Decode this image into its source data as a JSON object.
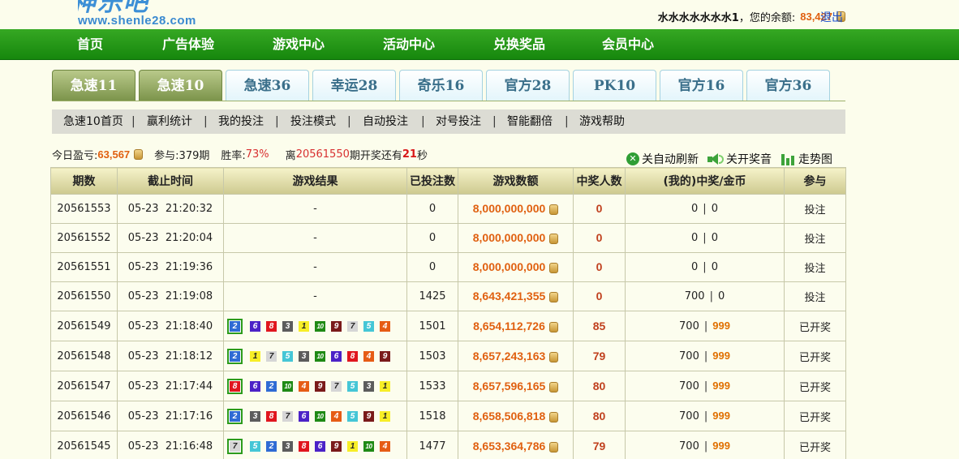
{
  "logo": {
    "url_text": "www.shenle28.com",
    "mark": "神乐吧"
  },
  "user": {
    "name": "水水水水水水水1",
    "separator": "，您的余额:",
    "balance": "83,427",
    "logout": "退出"
  },
  "nav": [
    "首页",
    "广告体验",
    "游戏中心",
    "活动中心",
    "兑换奖品",
    "会员中心"
  ],
  "tabs": [
    "急速11",
    "急速10",
    "急速36",
    "幸运28",
    "奇乐16",
    "官方28",
    "PK10",
    "官方16",
    "官方36"
  ],
  "subnav": [
    "急速10首页",
    "赢利统计",
    "我的投注",
    "投注模式",
    "自动投注",
    "对号投注",
    "智能翻倍",
    "游戏帮助"
  ],
  "stats": {
    "today_label": "今日盈亏:",
    "today_value": "63,567",
    "join_label": "参与:",
    "join_value": "379期",
    "rate_label": "胜率:",
    "rate_value": "73%",
    "countdown_pre": "离",
    "countdown_issue": "20561550",
    "countdown_mid": "期开奖还有",
    "countdown_secs": "21",
    "countdown_post": "秒"
  },
  "tools": {
    "refresh": "关自动刷新",
    "sound": "关开奖音",
    "trend": "走势图"
  },
  "table": {
    "headers": [
      "期数",
      "截止时间",
      "游戏结果",
      "已投注数",
      "游戏数额",
      "中奖人数",
      "(我的)中奖/金币",
      "参与"
    ],
    "rows": [
      {
        "issue": "20561553",
        "time": "05-23  21:20:32",
        "result": "-",
        "bets": "0",
        "amount": "8,000,000,000",
        "winners": "0",
        "mine_bet": "0",
        "mine_win": "0",
        "action": "投注"
      },
      {
        "issue": "20561552",
        "time": "05-23  21:20:04",
        "result": "-",
        "bets": "0",
        "amount": "8,000,000,000",
        "winners": "0",
        "mine_bet": "0",
        "mine_win": "0",
        "action": "投注"
      },
      {
        "issue": "20561551",
        "time": "05-23  21:19:36",
        "result": "-",
        "bets": "0",
        "amount": "8,000,000,000",
        "winners": "0",
        "mine_bet": "0",
        "mine_win": "0",
        "action": "投注"
      },
      {
        "issue": "20561550",
        "time": "05-23  21:19:08",
        "result": "-",
        "bets": "1425",
        "amount": "8,643,421,355",
        "winners": "0",
        "mine_bet": "700",
        "mine_win": "0",
        "action": "投注"
      },
      {
        "issue": "20561549",
        "time": "05-23  21:18:40",
        "balls": [
          2,
          6,
          8,
          3,
          1,
          10,
          9,
          7,
          5,
          4
        ],
        "bets": "1501",
        "amount": "8,654,112,726",
        "winners": "85",
        "mine_bet": "700",
        "mine_win": "999",
        "action": "已开奖"
      },
      {
        "issue": "20561548",
        "time": "05-23  21:18:12",
        "balls": [
          2,
          1,
          7,
          5,
          3,
          10,
          6,
          8,
          4,
          9
        ],
        "bets": "1503",
        "amount": "8,657,243,163",
        "winners": "79",
        "mine_bet": "700",
        "mine_win": "999",
        "action": "已开奖"
      },
      {
        "issue": "20561547",
        "time": "05-23  21:17:44",
        "balls": [
          8,
          6,
          2,
          10,
          4,
          9,
          7,
          5,
          3,
          1
        ],
        "bets": "1533",
        "amount": "8,657,596,165",
        "winners": "80",
        "mine_bet": "700",
        "mine_win": "999",
        "action": "已开奖"
      },
      {
        "issue": "20561546",
        "time": "05-23  21:17:16",
        "balls": [
          2,
          3,
          8,
          7,
          6,
          10,
          4,
          5,
          9,
          1
        ],
        "bets": "1518",
        "amount": "8,658,506,818",
        "winners": "80",
        "mine_bet": "700",
        "mine_win": "999",
        "action": "已开奖"
      },
      {
        "issue": "20561545",
        "time": "05-23  21:16:48",
        "balls": [
          7,
          5,
          2,
          3,
          8,
          6,
          9,
          1,
          10,
          4
        ],
        "bets": "1477",
        "amount": "8,653,364,786",
        "winners": "79",
        "mine_bet": "700",
        "mine_win": "999",
        "action": "已开奖"
      }
    ]
  }
}
